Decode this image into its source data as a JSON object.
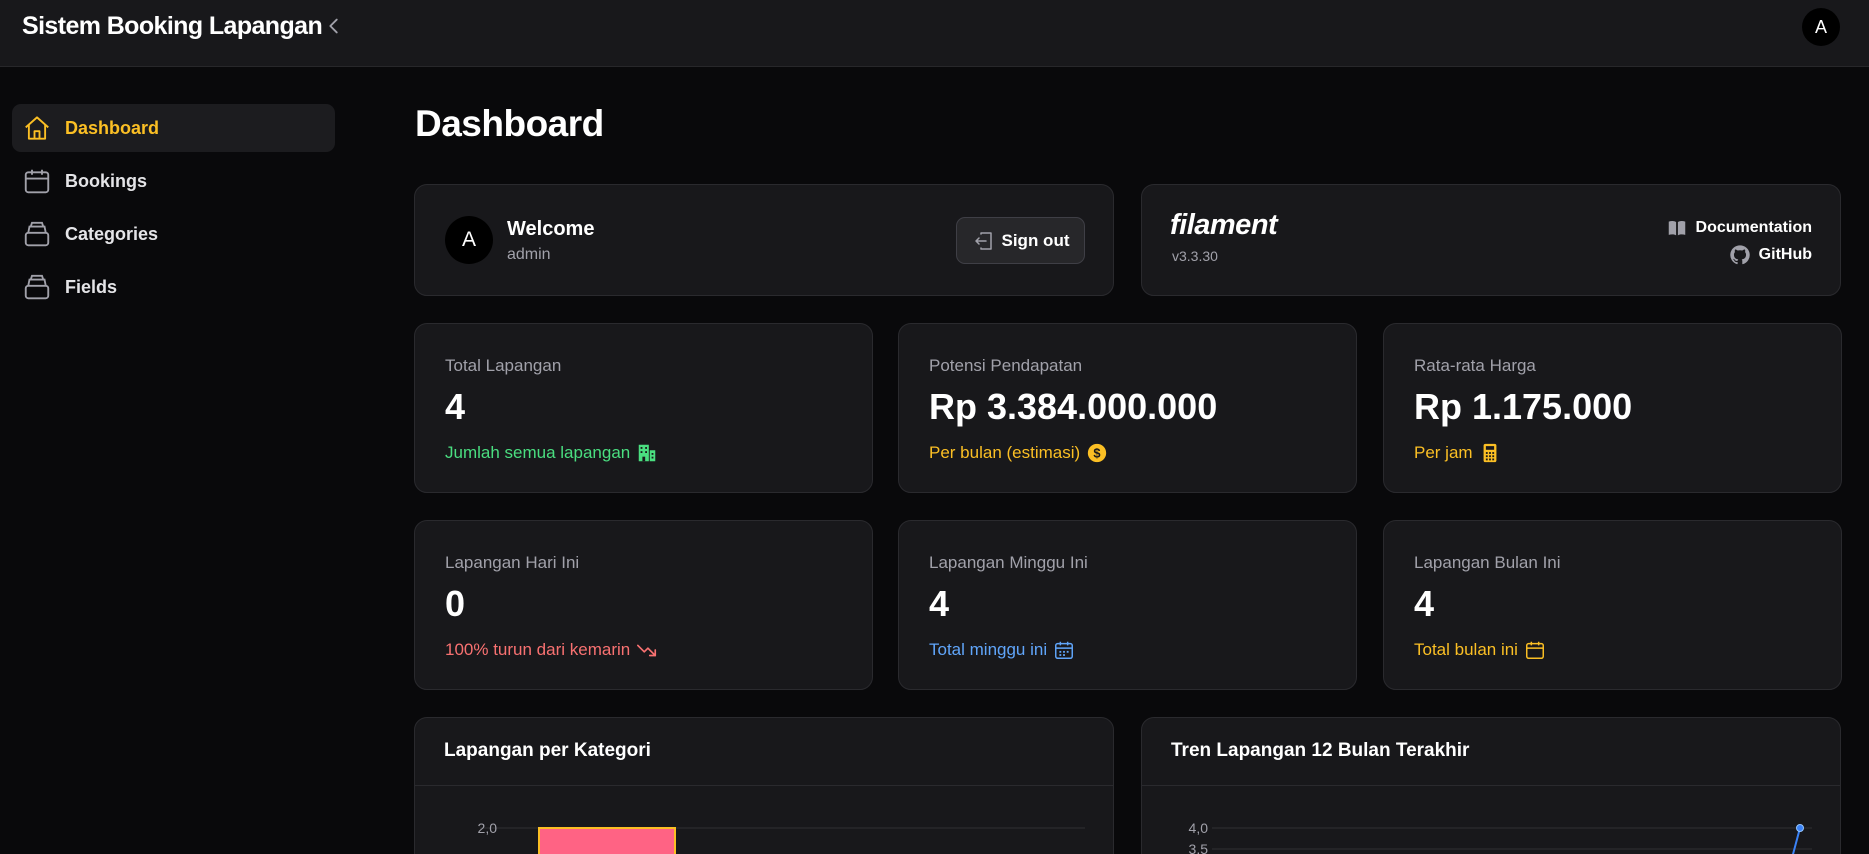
{
  "topbar": {
    "app_title": "Sistem Booking Lapangan",
    "user_initial": "A"
  },
  "sidebar": {
    "items": [
      {
        "label": "Dashboard",
        "icon": "home-icon",
        "active": true
      },
      {
        "label": "Bookings",
        "icon": "calendar-icon"
      },
      {
        "label": "Categories",
        "icon": "inbox-stack-icon"
      },
      {
        "label": "Fields",
        "icon": "inbox-stack-icon"
      }
    ]
  },
  "page": {
    "title": "Dashboard"
  },
  "account_widget": {
    "initial": "A",
    "welcome": "Welcome",
    "username": "admin",
    "signout_label": "Sign out"
  },
  "filament_widget": {
    "logo_text": "filament",
    "version": "v3.3.30",
    "documentation_label": "Documentation",
    "github_label": "GitHub"
  },
  "stats": [
    {
      "label": "Total Lapangan",
      "value": "4",
      "description": "Jumlah semua lapangan",
      "color": "#4ade80",
      "icon": "building-office-icon"
    },
    {
      "label": "Potensi Pendapatan",
      "value": "Rp 3.384.000.000",
      "description": "Per bulan (estimasi)",
      "color": "#fbbf24",
      "icon": "currency-dollar-icon"
    },
    {
      "label": "Rata-rata Harga",
      "value": "Rp 1.175.000",
      "description": "Per jam",
      "color": "#fbbf24",
      "icon": "calculator-icon"
    },
    {
      "label": "Lapangan Hari Ini",
      "value": "0",
      "description": "100% turun dari kemarin",
      "color": "#f87171",
      "icon": "trending-down-icon"
    },
    {
      "label": "Lapangan Minggu Ini",
      "value": "4",
      "description": "Total minggu ini",
      "color": "#60a5fa",
      "icon": "calendar-days-icon"
    },
    {
      "label": "Lapangan Bulan Ini",
      "value": "4",
      "description": "Total bulan ini",
      "color": "#fbbf24",
      "icon": "calendar-icon"
    }
  ],
  "chart_data": [
    {
      "type": "bar",
      "title": "Lapangan per Kategori",
      "categories": [
        ""
      ],
      "values": [
        2
      ],
      "y_tick_labels": [
        "2,0"
      ],
      "bar_color": "#ff6384",
      "bar_border_color": "#fbbf24"
    },
    {
      "type": "line",
      "title": "Tren Lapangan 12 Bulan Terakhir",
      "y_tick_labels": [
        "4,0",
        "3,5"
      ],
      "last_value": 4,
      "line_color": "#3b82f6"
    }
  ]
}
